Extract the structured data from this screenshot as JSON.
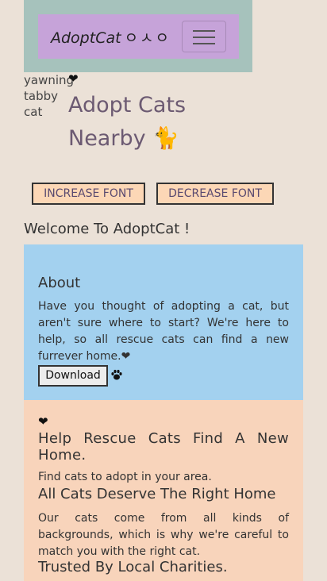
{
  "navbar": {
    "brand": "AdoptCat",
    "brand_korean": "ㅇㅅㅇ",
    "toggler_icon": "hamburger-icon"
  },
  "hero": {
    "image_alt": "yawning tabby cat",
    "heart": "❤",
    "heading": "Adopt Cats Nearby 🐈"
  },
  "controls": {
    "increase_label": "INCREASE FONT",
    "decrease_label": "DECREASE FONT"
  },
  "welcome": "Welcome To AdoptCat !",
  "about": {
    "title": "About",
    "text": "Have you thought of adopting a cat, but aren't sure where to start? We're here to help, so all rescue cats can find a new furrever home.❤",
    "download_label": "Download",
    "paw_icon": "paw-icon"
  },
  "help": {
    "heart": "❤",
    "title": "Help Rescue Cats Find A New Home.",
    "subtitle": "Find cats to adopt in your area.",
    "all_cats_title": "All Cats Deserve The Right Home",
    "all_cats_text": "Our cats come from all kinds of backgrounds, which is why we're careful to match you with the right cat.",
    "trusted_title": "Trusted By Local Charities."
  },
  "colors": {
    "page_bg": "#ebe1d7",
    "navbar_outer": "#a6c2bc",
    "navbar_inner": "#c6a3d9",
    "about_bg": "#a3d1ef",
    "help_bg": "#f8d4bb",
    "font_button_bg": "#fcd7b6",
    "heading": "#6c5a72"
  }
}
